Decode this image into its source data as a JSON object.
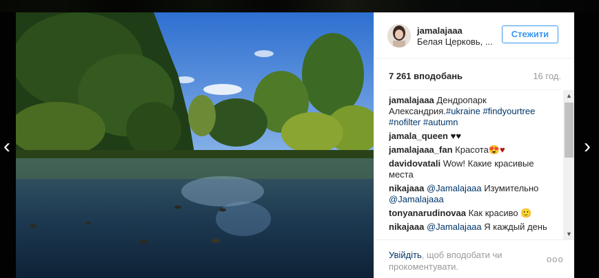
{
  "post": {
    "username": "jamalajaaa",
    "location": "Белая Церковь, ...",
    "follow_label": "Стежити",
    "likes": "7 261 вподобань",
    "time": "16 год."
  },
  "caption": {
    "user": "jamalajaaa",
    "text": "Дендропарк Александрия.",
    "tags": [
      "#ukraine",
      "#findyourtree",
      "#nofilter",
      "#autumn"
    ]
  },
  "comments": [
    {
      "user": "jamala_queen",
      "text": "",
      "emoji": "♥♥"
    },
    {
      "user": "jamalajaaa_fan",
      "text": "Красота",
      "emoji": "😍♥"
    },
    {
      "user": "davidovatali",
      "text": "Wow! Какие красивые места"
    },
    {
      "user": "nikajaaa",
      "mention": "@Jamalajaaa",
      "text": "Изумительно",
      "mention2": "@Jamalajaaa"
    },
    {
      "user": "tonyanarudinovaa",
      "text": "Как красиво",
      "emoji": "🙂"
    },
    {
      "user": "nikajaaa",
      "mention": "@Jamalajaaa",
      "text": "Я каждый день"
    }
  ],
  "footer": {
    "login_link": "Увійдіть",
    "login_rest": ", щоб вподобати чи прокоментувати.",
    "more": "ooo"
  },
  "nav": {
    "prev": "‹",
    "next": "›"
  },
  "scroll": {
    "up": "▲",
    "down": "▼"
  }
}
